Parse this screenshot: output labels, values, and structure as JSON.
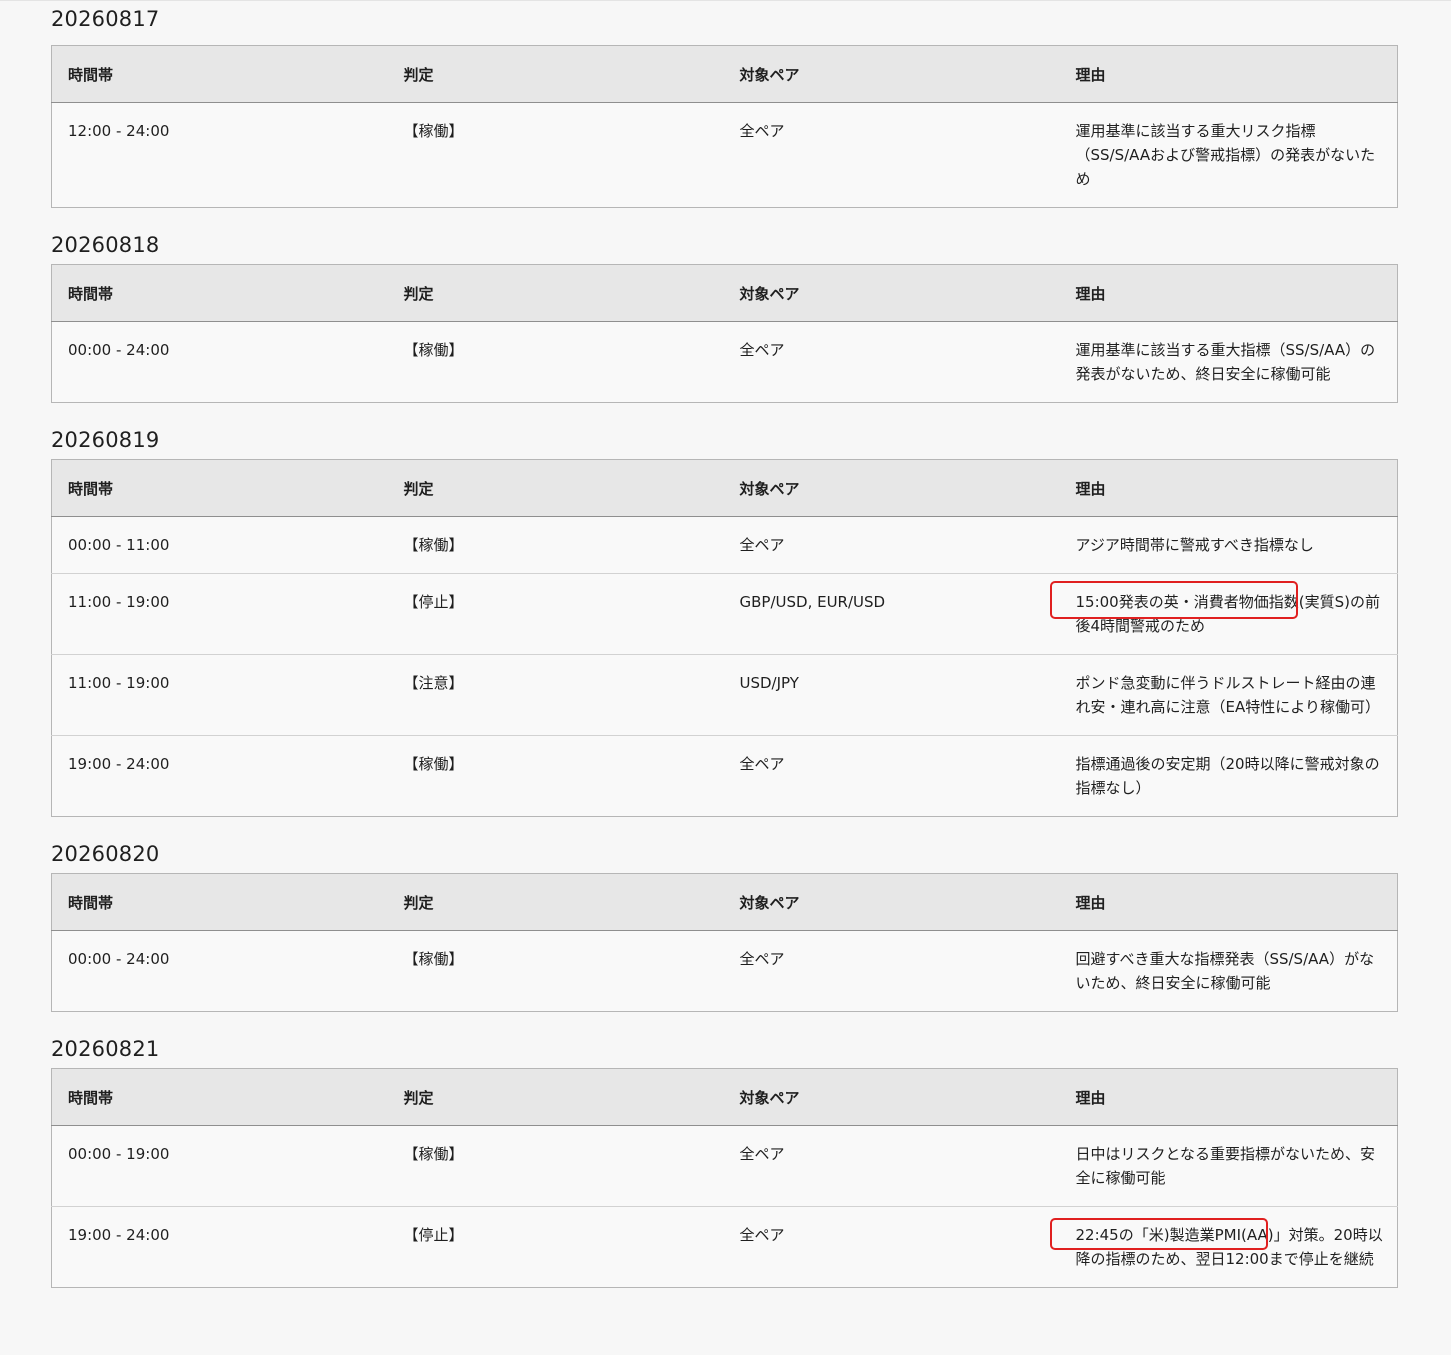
{
  "headers": {
    "time": "時間帯",
    "judgement": "判定",
    "pairs": "対象ペア",
    "reason": "理由"
  },
  "days": [
    {
      "date": "20260817",
      "rows": [
        {
          "time": "12:00 - 24:00",
          "judgement": "【稼働】",
          "pairs": "全ペア",
          "reason": "運用基準に該当する重大リスク指標（SS/S/AAおよび警戒指標）の発表がないため"
        }
      ]
    },
    {
      "date": "20260818",
      "rows": [
        {
          "time": "00:00 - 24:00",
          "judgement": "【稼働】",
          "pairs": "全ペア",
          "reason": "運用基準に該当する重大指標（SS/S/AA）の発表がないため、終日安全に稼働可能"
        }
      ]
    },
    {
      "date": "20260819",
      "rows": [
        {
          "time": "00:00 - 11:00",
          "judgement": "【稼働】",
          "pairs": "全ペア",
          "reason": "アジア時間帯に警戒すべき指標なし"
        },
        {
          "time": "11:00 - 19:00",
          "judgement": "【停止】",
          "pairs": "GBP/USD, EUR/USD",
          "reason": "15:00発表の英・消費者物価指数(実質S)の前後4時間警戒のため"
        },
        {
          "time": "11:00 - 19:00",
          "judgement": "【注意】",
          "pairs": "USD/JPY",
          "reason": "ポンド急変動に伴うドルストレート経由の連れ安・連れ高に注意（EA特性により稼働可）"
        },
        {
          "time": "19:00 - 24:00",
          "judgement": "【稼働】",
          "pairs": "全ペア",
          "reason": "指標通過後の安定期（20時以降に警戒対象の指標なし）"
        }
      ]
    },
    {
      "date": "20260820",
      "rows": [
        {
          "time": "00:00 - 24:00",
          "judgement": "【稼働】",
          "pairs": "全ペア",
          "reason": "回避すべき重大な指標発表（SS/S/AA）がないため、終日安全に稼働可能"
        }
      ]
    },
    {
      "date": "20260821",
      "rows": [
        {
          "time": "00:00 - 19:00",
          "judgement": "【稼働】",
          "pairs": "全ペア",
          "reason": "日中はリスクとなる重要指標がないため、安全に稼働可能"
        },
        {
          "time": "19:00 - 24:00",
          "judgement": "【停止】",
          "pairs": "全ペア",
          "reason": "22:45の「米)製造業PMI(AA)」対策。20時以降の指標のため、翌日12:00まで停止を継続"
        }
      ]
    }
  ],
  "colors": {
    "highlight": "#e02020",
    "header_bg": "#e7e7e7",
    "page_bg": "#f7f7f7"
  }
}
